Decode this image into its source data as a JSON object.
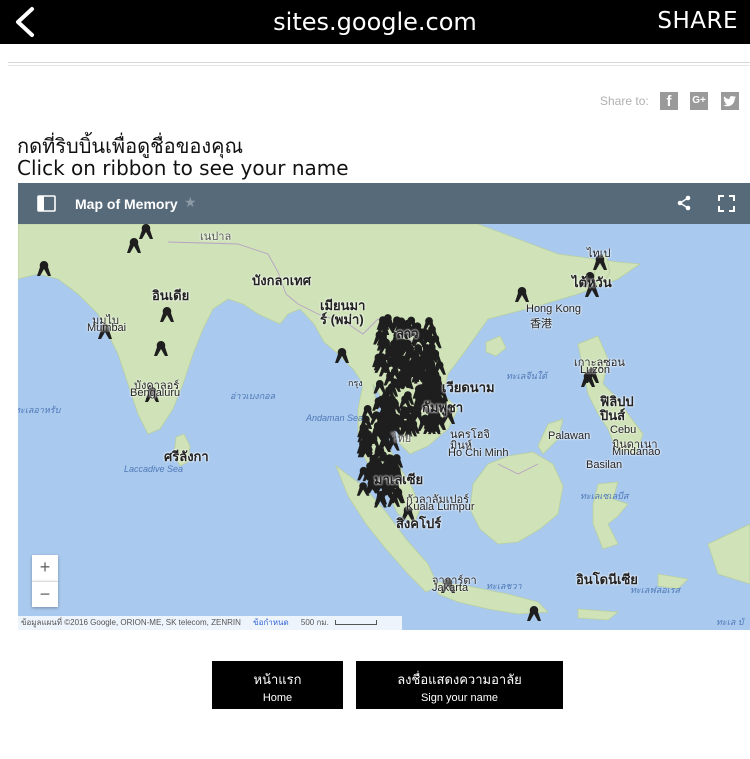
{
  "browser": {
    "url": "sites.google.com",
    "share_label": "SHARE"
  },
  "share_bar": {
    "label": "Share to:",
    "icons": [
      "facebook-icon",
      "google-plus-icon",
      "twitter-icon"
    ],
    "gplus_text": "G+",
    "fb_text": "f"
  },
  "heading": {
    "thai": "กดที่ริบบิ้นเพื่อดูชื่อของคุณ",
    "english": "Click on ribbon to see your name"
  },
  "map": {
    "title": "Map of Memory",
    "labels": {
      "nepal": "เนปาล",
      "bangladesh": "บังกลาเทศ",
      "india": "อินเดีย",
      "mumbai_th": "มุมไบ",
      "mumbai_en": "Mumbai",
      "myanmar_1": "เมียนมา",
      "myanmar_2": "ร์ (พม่า)",
      "laos": "ลาว",
      "taipei": "ไทเป",
      "taiwan": "ไต้หวัน",
      "hongkong_en": "Hong Kong",
      "hongkong_zh": "香港",
      "bengaluru_th": "บังคาลอร์",
      "bengaluru_en": "Bengaluru",
      "bay_of_bengal": "อ่าวเบงกอล",
      "arabian_sea": "ทะเลอาหรับ",
      "south_china_sea": "ทะเลจีนใต้",
      "luzon_th": "เกาะลูซอน",
      "luzon_en": "Luzon",
      "philippines_1": "ฟิลิปป",
      "philippines_2": "ปินส์",
      "vietnam": "เวียดนาม",
      "cambodia": "กัมพูชา",
      "andaman": "Andaman Sea",
      "thailand": "ไทย",
      "hcm_th": "นครโฮจิ",
      "hcm_th2": "มินห์",
      "hcm_en": "Ho Chi Minh",
      "palawan": "Palawan",
      "cebu_en": "Cebu",
      "mindanao_th": "มินดาเนา",
      "mindanao_en": "Mindanao",
      "basilan": "Basilan",
      "srilanka": "ศรีลังกา",
      "laccadive": "Laccadive Sea",
      "malaysia": "มาเลเซีย",
      "kl_th": "กัวลาลัมเปอร์",
      "kl_en": "Kuala Lumpur",
      "singapore": "สิงคโปร์",
      "celebes_sea": "ทะเลเซเลบีส",
      "indonesia": "อินโดนีเซีย",
      "jakarta_th": "จาการ์ตา",
      "jakarta_en": "Jakarta",
      "java_sea": "ทะเลชวา",
      "flores_sea": "ทะเลฟลอเรส",
      "banda_sea": "ทะเล บั",
      "bangkok": "กรุง"
    },
    "zoom_in": "+",
    "zoom_out": "−",
    "attribution": "ข้อมูลแผนที่ ©2016 Google, ORION-ME, SK telecom, ZENRIN",
    "terms": "ข้อกำหนด",
    "scale": "500 กม."
  },
  "buttons": {
    "home_th": "หน้าแรก",
    "home_en": "Home",
    "sign_th": "ลงชื่อแสดงความอาลัย",
    "sign_en": "Sign your name"
  },
  "colors": {
    "topbar": "#000000",
    "map_header": "#566a7a",
    "water": "#a9c9ee",
    "land": "#cfe2b8",
    "ribbon": "#222222"
  }
}
